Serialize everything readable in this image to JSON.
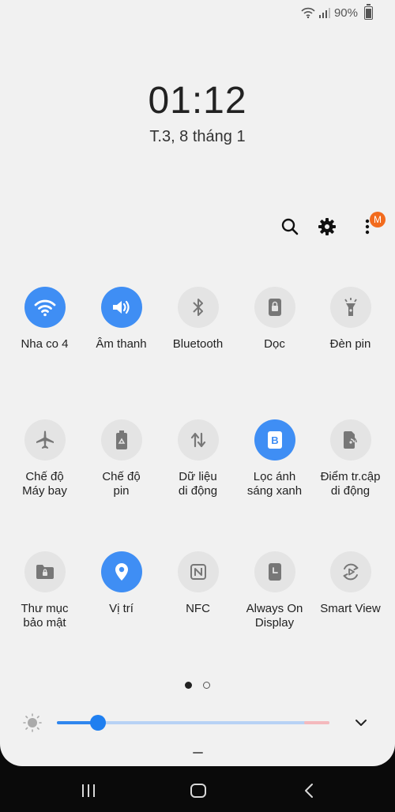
{
  "status_bar": {
    "battery": "90%",
    "battery_level": 0.9,
    "wifi_icon": "wifi-icon",
    "signal_icon": "signal-icon"
  },
  "clock": {
    "time": "01:12",
    "date": "T.3, 8 tháng 1"
  },
  "top_actions": {
    "search_icon": "search-icon",
    "settings_icon": "gear-icon",
    "more_icon": "more-vert-icon",
    "badge": "M"
  },
  "tiles": [
    {
      "label": "Nha co 4",
      "icon": "wifi-icon",
      "on": true
    },
    {
      "label": "Âm thanh",
      "icon": "sound-icon",
      "on": true
    },
    {
      "label": "Bluetooth",
      "icon": "bluetooth-icon",
      "on": false
    },
    {
      "label": "Dọc",
      "icon": "portrait-lock-icon",
      "on": false
    },
    {
      "label": "Đèn pin",
      "icon": "flashlight-icon",
      "on": false
    },
    {
      "label": "Chế độ\nMáy bay",
      "icon": "airplane-icon",
      "on": false
    },
    {
      "label": "Chế độ\npin",
      "icon": "battery-saver-icon",
      "on": false
    },
    {
      "label": "Dữ liệu\ndi động",
      "icon": "mobile-data-icon",
      "on": false
    },
    {
      "label": "Lọc ánh\nsáng xanh",
      "icon": "blue-light-filter-icon",
      "on": true
    },
    {
      "label": "Điểm tr.cập\ndi động",
      "icon": "hotspot-icon",
      "on": false
    },
    {
      "label": "Thư mục\nbảo mật",
      "icon": "secure-folder-icon",
      "on": false
    },
    {
      "label": "Vị trí",
      "icon": "location-icon",
      "on": true
    },
    {
      "label": "NFC",
      "icon": "nfc-icon",
      "on": false
    },
    {
      "label": "Always On\nDisplay",
      "icon": "always-on-display-icon",
      "on": false
    },
    {
      "label": "Smart View",
      "icon": "smart-view-icon",
      "on": false
    }
  ],
  "pager": {
    "pages": 2,
    "current": 1
  },
  "brightness": {
    "level": 0.15
  },
  "colors": {
    "accent": "#3f8ef4",
    "tile_off": "#e4e4e4",
    "icon_off": "#6f6f6f",
    "badge": "#f26b1d"
  },
  "navbar": {
    "recents_icon": "recents-icon",
    "home_icon": "home-icon",
    "back_icon": "back-icon"
  }
}
